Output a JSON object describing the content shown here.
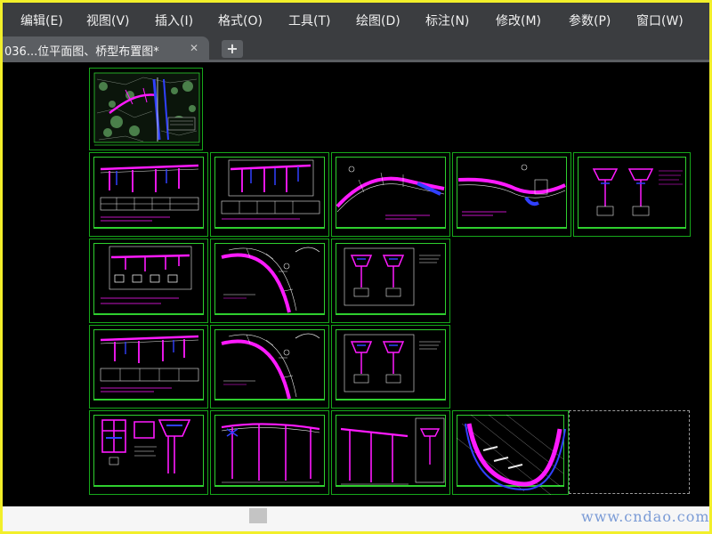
{
  "menubar": {
    "items": [
      "编辑(E)",
      "视图(V)",
      "插入(I)",
      "格式(O)",
      "工具(T)",
      "绘图(D)",
      "标注(N)",
      "修改(M)",
      "参数(P)",
      "窗口(W)"
    ]
  },
  "tabs": {
    "active_label": "036...位平面图、桥型布置图*",
    "close_glyph": "✕",
    "new_tab_glyph": "+"
  },
  "watermark": {
    "text": "www.cndao.com"
  },
  "colors": {
    "background": "#000000",
    "sheet_border": "#16a81a",
    "drawing_magenta": "#ff1aff",
    "drawing_blue": "#3040ff",
    "drawing_white": "#e8e8e8",
    "frame": "#f2ef2a"
  },
  "drawing": {
    "sheet_grid": [
      [
        "site-plan"
      ],
      [
        "elevation",
        "elevation",
        "curve-plan",
        "curve-plan",
        "cross-section"
      ],
      [
        "elevation",
        "curve-plan",
        "cross-section"
      ],
      [
        "elevation",
        "curve-plan",
        "cross-section"
      ],
      [
        "pier-detail",
        "tall-elevation",
        "tall-elevation",
        "arc-plan"
      ]
    ]
  }
}
